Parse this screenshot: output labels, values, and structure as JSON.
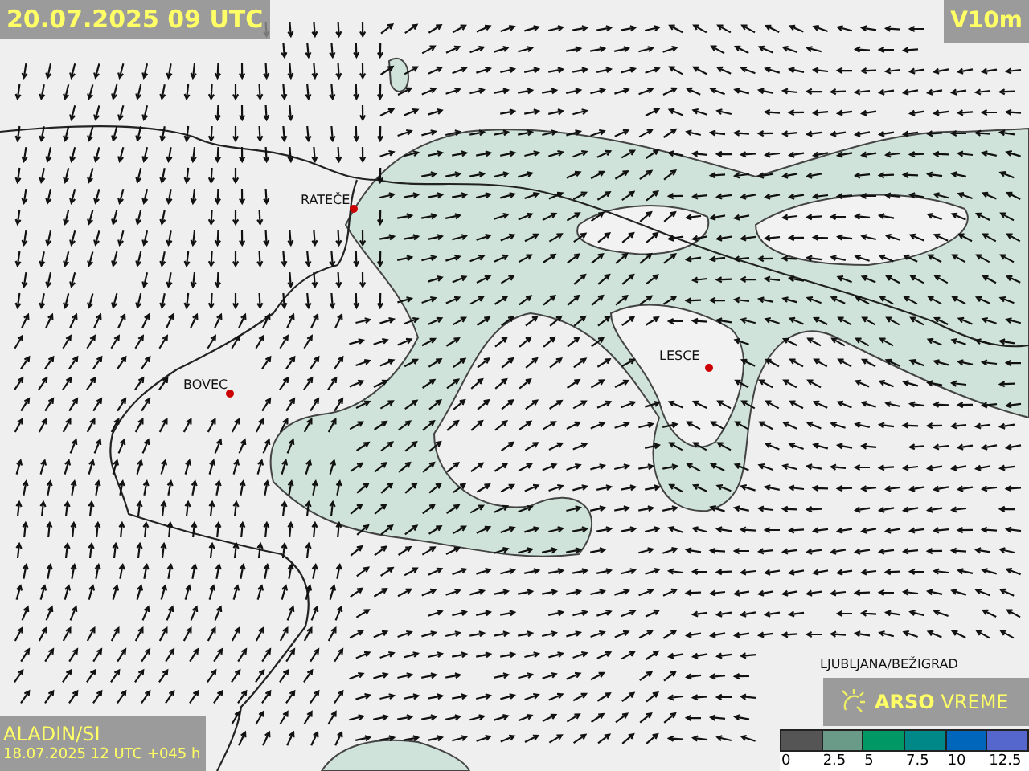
{
  "valid_time": "20.07.2025 09 UTC",
  "parameter": "V10m",
  "model": {
    "name": "ALADIN/SI",
    "run": "18.07.2025 12 UTC +045 h"
  },
  "stations": [
    {
      "name": "RATEČE"
    },
    {
      "name": "BOVEC"
    },
    {
      "name": "LESCE"
    },
    {
      "name": "LJUBLJANA/BEŽIGRAD"
    }
  ],
  "logo": {
    "brand": "ARSO",
    "product": "VREME"
  },
  "legend": [
    {
      "label": "0",
      "color": "#555555"
    },
    {
      "label": "2.5",
      "color": "#6a9a88"
    },
    {
      "label": "5",
      "color": "#009966"
    },
    {
      "label": "7.5",
      "color": "#008888"
    },
    {
      "label": "10",
      "color": "#0066bb"
    },
    {
      "label": "12.5",
      "color": "#5566cc"
    }
  ]
}
